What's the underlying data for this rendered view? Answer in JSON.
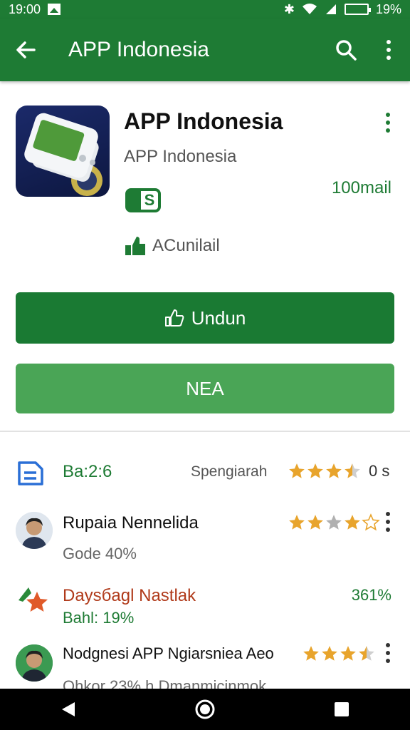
{
  "status": {
    "time": "19:00",
    "battery": "19%"
  },
  "appbar": {
    "title": "APP Indonesia"
  },
  "app": {
    "name": "APP Indonesia",
    "developer": "APP Indonesia",
    "badge": "S",
    "downloads": "100mail",
    "contains": "ACunilail"
  },
  "buttons": {
    "install": "Undun",
    "secondary": "NEA"
  },
  "summary": {
    "label": "Ba:2:6",
    "sub": "Spengiarah",
    "count": "0 s",
    "stars": 3.5
  },
  "reviews": [
    {
      "title": "Rupaia Nennelida",
      "sub": "Gode 40%",
      "stars": 3.5
    },
    {
      "title": "Daysбagl Nastlak",
      "sub": "Bahl: 19%",
      "value": "361%"
    },
    {
      "title": "Nodgnesi APP Ngiarsniea Aeo",
      "sub": "Ohkor 23% h Dmanmicinmok",
      "stars": 3.5
    }
  ],
  "colors": {
    "primary": "#1e7b34",
    "secondary": "#4aa556",
    "star": "#e8a42c"
  }
}
